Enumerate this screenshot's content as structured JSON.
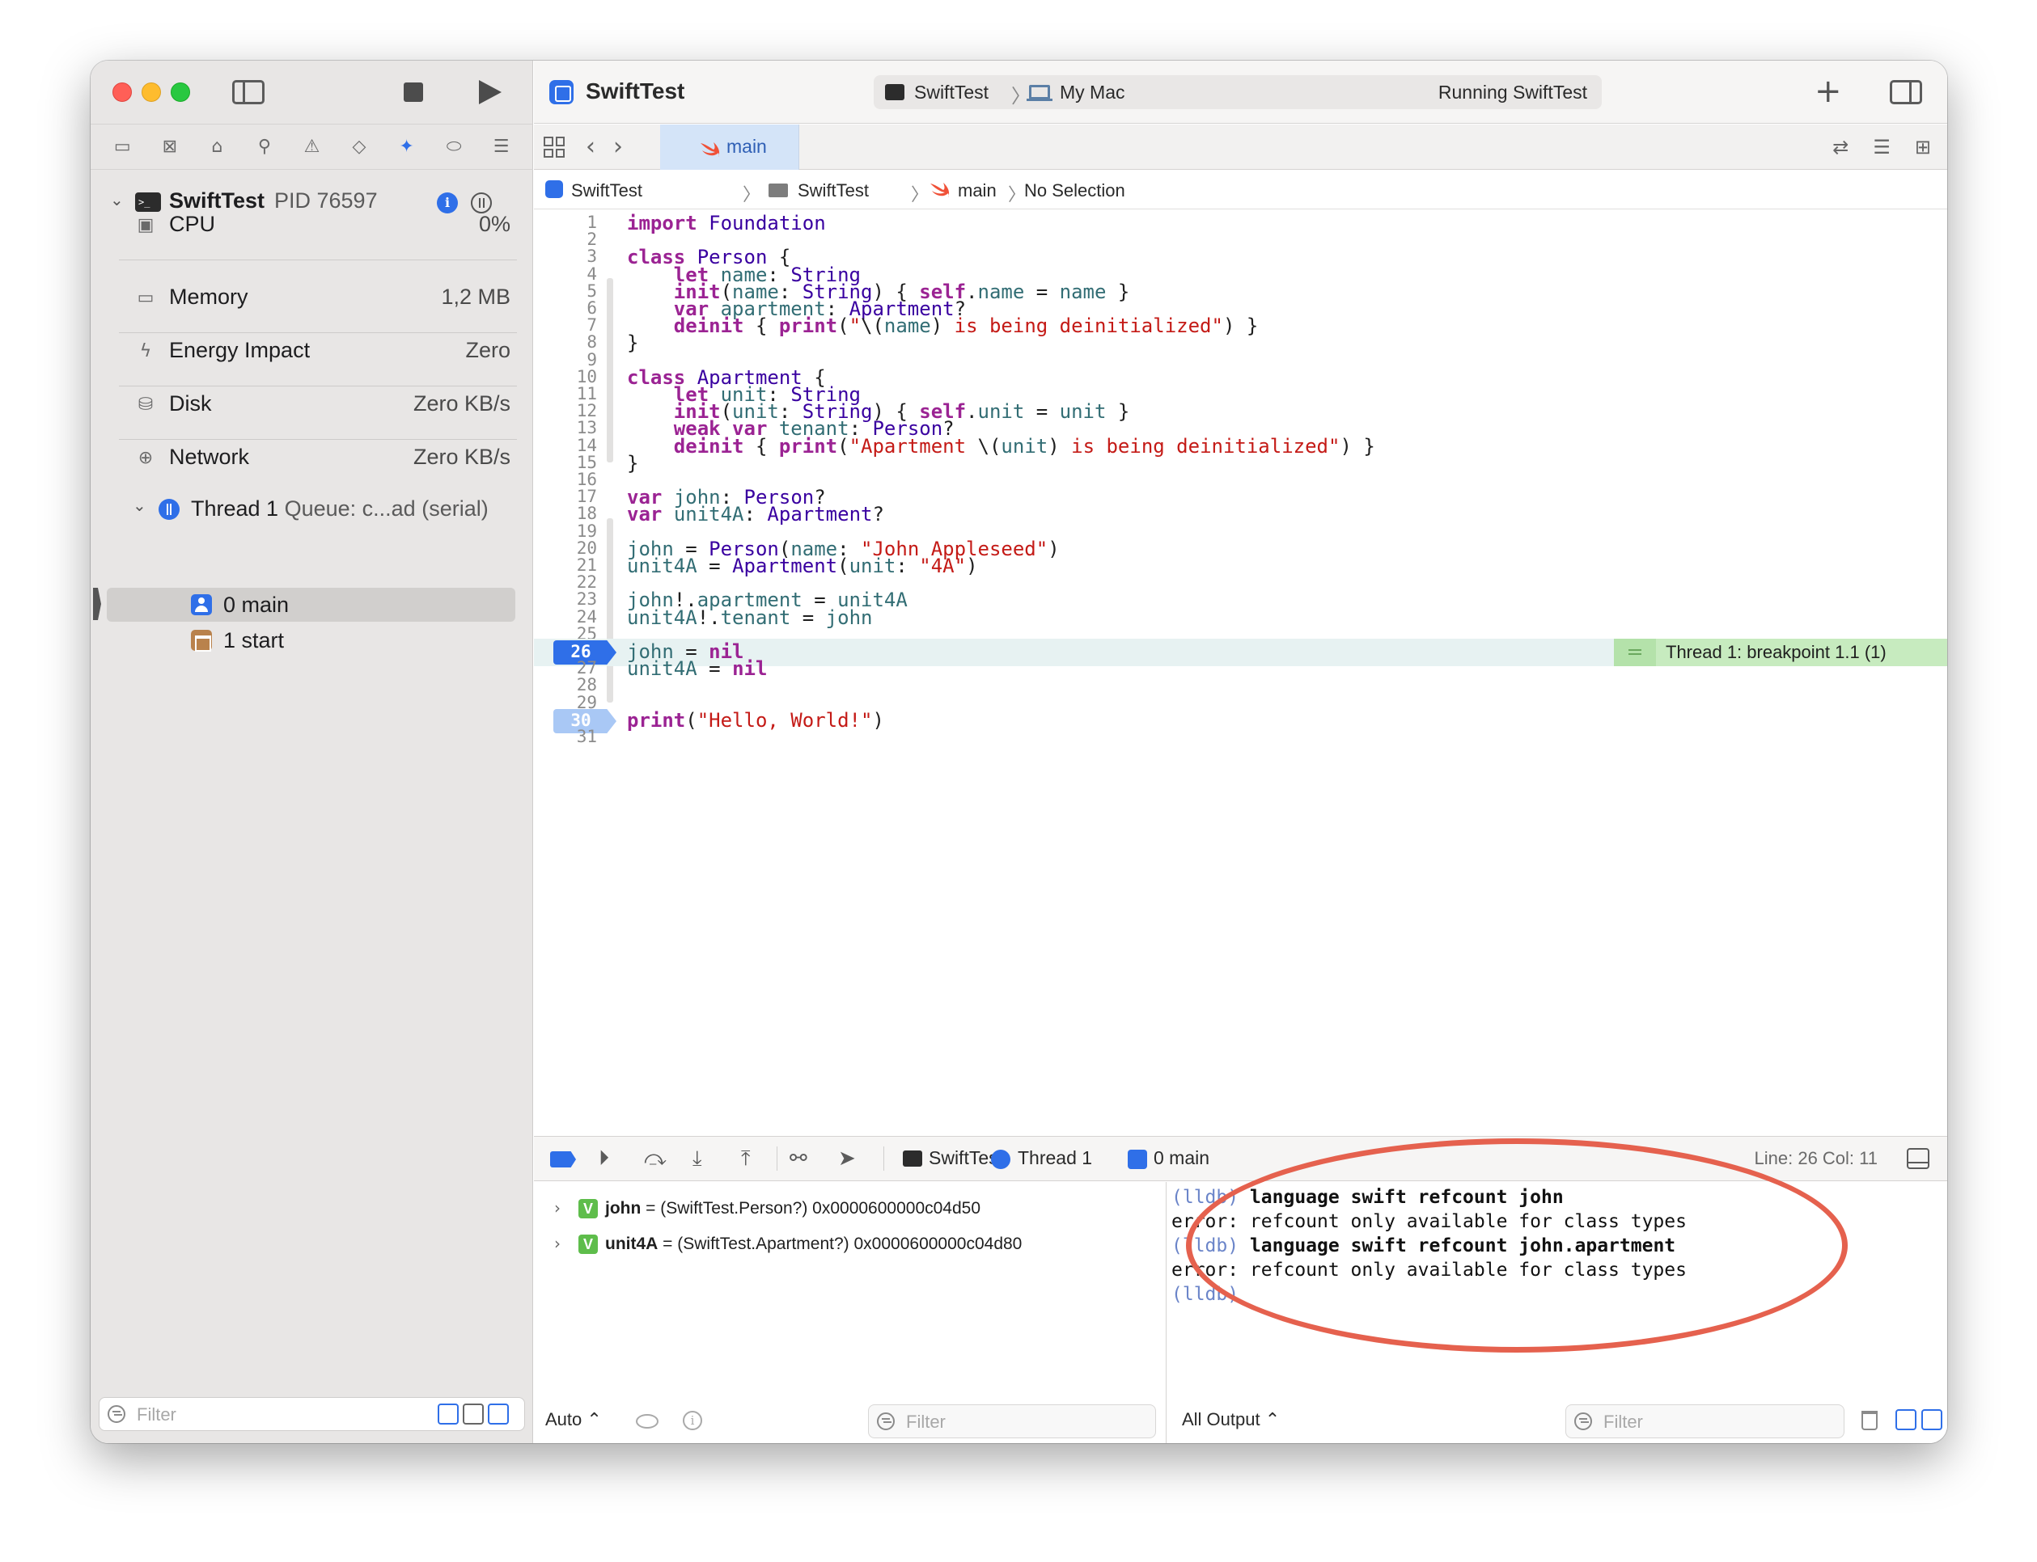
{
  "window": {
    "app_title": "SwiftTest",
    "scheme": "SwiftTest",
    "destination": "My Mac",
    "status": "Running SwiftTest",
    "editor_tab": "main"
  },
  "sidebar": {
    "process": {
      "name": "SwiftTest",
      "pid": "PID 76597"
    },
    "gauges": [
      {
        "icon": "cpu-icon",
        "label": "CPU",
        "value": "0%"
      },
      {
        "icon": "memory-icon",
        "label": "Memory",
        "value": "1,2 MB"
      },
      {
        "icon": "energy-icon",
        "label": "Energy Impact",
        "value": "Zero"
      },
      {
        "icon": "disk-icon",
        "label": "Disk",
        "value": "Zero KB/s"
      },
      {
        "icon": "network-icon",
        "label": "Network",
        "value": "Zero KB/s"
      }
    ],
    "thread": {
      "name": "Thread 1",
      "queue": "Queue: c...ad (serial)"
    },
    "frames": [
      {
        "label": "0 main",
        "selected": true
      },
      {
        "label": "1 start",
        "selected": false
      }
    ],
    "filter_placeholder": "Filter"
  },
  "jump_bar": [
    "SwiftTest",
    "SwiftTest",
    "main",
    "No Selection"
  ],
  "code": {
    "current_line": 26,
    "breakpoint_lines": [
      26,
      30
    ],
    "breakpoint_label": "Thread 1: breakpoint 1.1 (1)",
    "lines": [
      "import Foundation",
      "",
      "class Person {",
      "    let name: String",
      "    init(name: String) { self.name = name }",
      "    var apartment: Apartment?",
      "    deinit { print(\"\\(name) is being deinitialized\") }",
      "}",
      "",
      "class Apartment {",
      "    let unit: String",
      "    init(unit: String) { self.unit = unit }",
      "    weak var tenant: Person?",
      "    deinit { print(\"Apartment \\(unit) is being deinitialized\") }",
      "}",
      "",
      "var john: Person?",
      "var unit4A: Apartment?",
      "",
      "john = Person(name: \"John Appleseed\")",
      "unit4A = Apartment(unit: \"4A\")",
      "",
      "john!.apartment = unit4A",
      "unit4A!.tenant = john",
      "",
      "john = nil",
      "unit4A = nil",
      "",
      "",
      "print(\"Hello, World!\")",
      ""
    ]
  },
  "debug_bar": {
    "crumbs": [
      "SwiftTest",
      "Thread 1",
      "0 main"
    ],
    "position": "Line: 26  Col: 11"
  },
  "variables": [
    {
      "name": "john",
      "value": " = (SwiftTest.Person?) 0x0000600000c04d50"
    },
    {
      "name": "unit4A",
      "value": " = (SwiftTest.Apartment?) 0x0000600000c04d80"
    }
  ],
  "variables_footer": {
    "mode": "Auto ⌃",
    "filter_placeholder": "Filter"
  },
  "console": {
    "lines": [
      {
        "prompt": "(lldb)",
        "text": " language swift refcount john",
        "kind": "cmd"
      },
      {
        "prompt": "",
        "text": "error: refcount only available for class types",
        "kind": "err"
      },
      {
        "prompt": "(lldb)",
        "text": " language swift refcount john.apartment",
        "kind": "cmd"
      },
      {
        "prompt": "",
        "text": "error: refcount only available for class types",
        "kind": "err"
      },
      {
        "prompt": "(lldb)",
        "text": "",
        "kind": "cmd"
      }
    ],
    "output_mode": "All Output ⌃",
    "filter_placeholder": "Filter"
  },
  "colors": {
    "accent": "#2f6fe8",
    "annotation": "#e5614e",
    "breakpoint_banner": "#c7ebbf"
  }
}
